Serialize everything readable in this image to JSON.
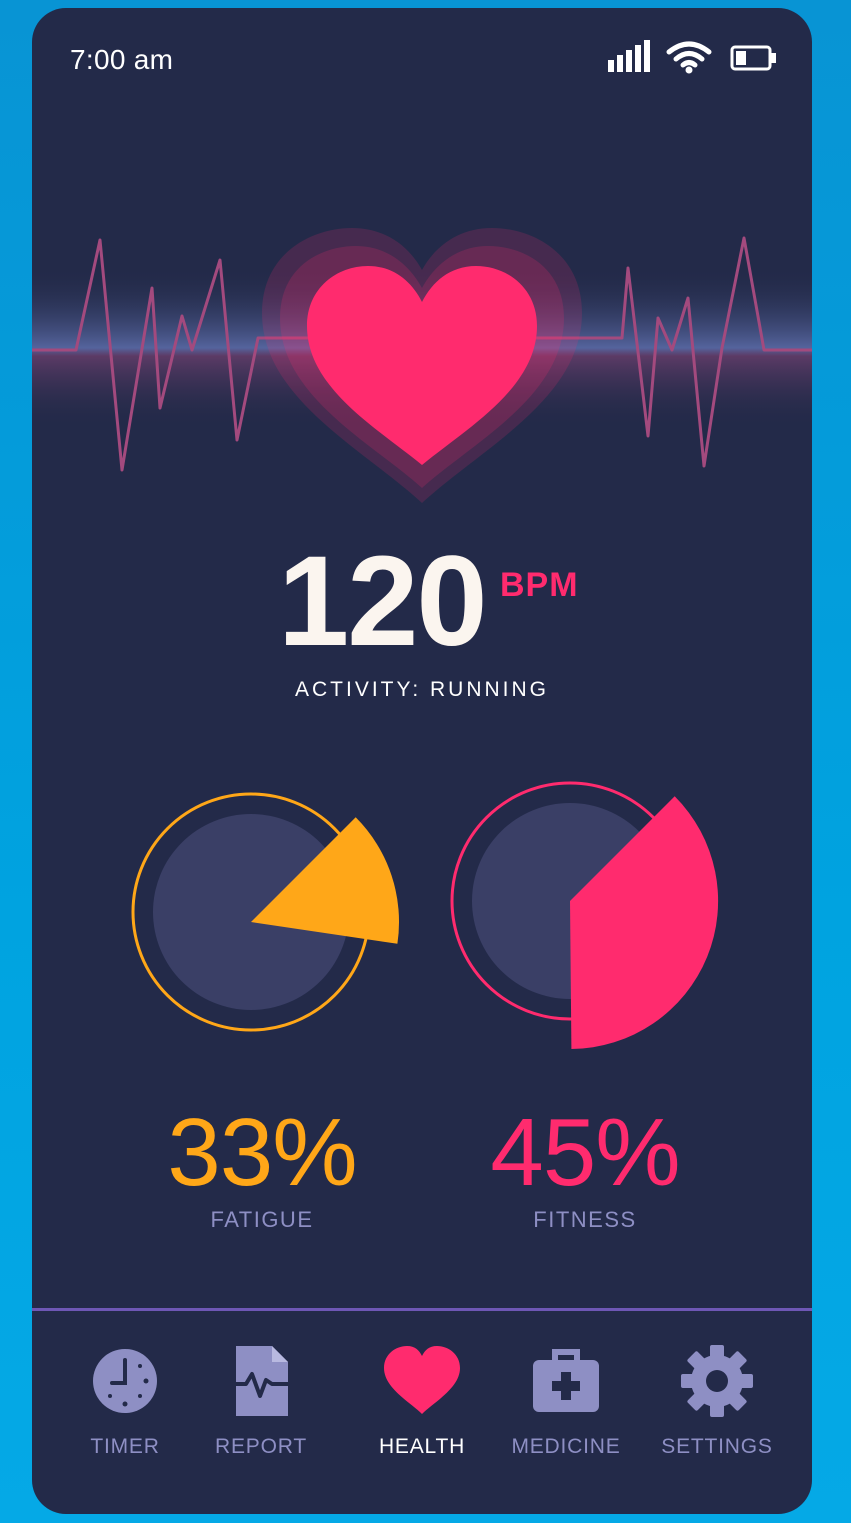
{
  "status_bar": {
    "time": "7:00 am",
    "icons": [
      "signal-icon",
      "wifi-icon",
      "battery-icon"
    ]
  },
  "heart_rate": {
    "value": "120",
    "unit": "BPM",
    "activity": "ACTIVITY: RUNNING"
  },
  "gauges": [
    {
      "name": "fatigue",
      "percent": 33,
      "label_value": "33%",
      "label": "FATIGUE",
      "color": "#ffa718"
    },
    {
      "name": "fitness",
      "percent": 45,
      "label_value": "45%",
      "label": "FITNESS",
      "color": "#ff2b6e"
    }
  ],
  "nav": {
    "items": [
      {
        "label": "TIMER",
        "icon": "clock-icon",
        "active": false
      },
      {
        "label": "REPORT",
        "icon": "report-icon",
        "active": false
      },
      {
        "label": "HEALTH",
        "icon": "heart-icon",
        "active": true
      },
      {
        "label": "MEDICINE",
        "icon": "medicine-icon",
        "active": false
      },
      {
        "label": "SETTINGS",
        "icon": "gear-icon",
        "active": false
      }
    ]
  },
  "colors": {
    "background": "#232a49",
    "accent_pink": "#ff2b6e",
    "accent_orange": "#ffa718",
    "muted": "#8e8fc4"
  }
}
